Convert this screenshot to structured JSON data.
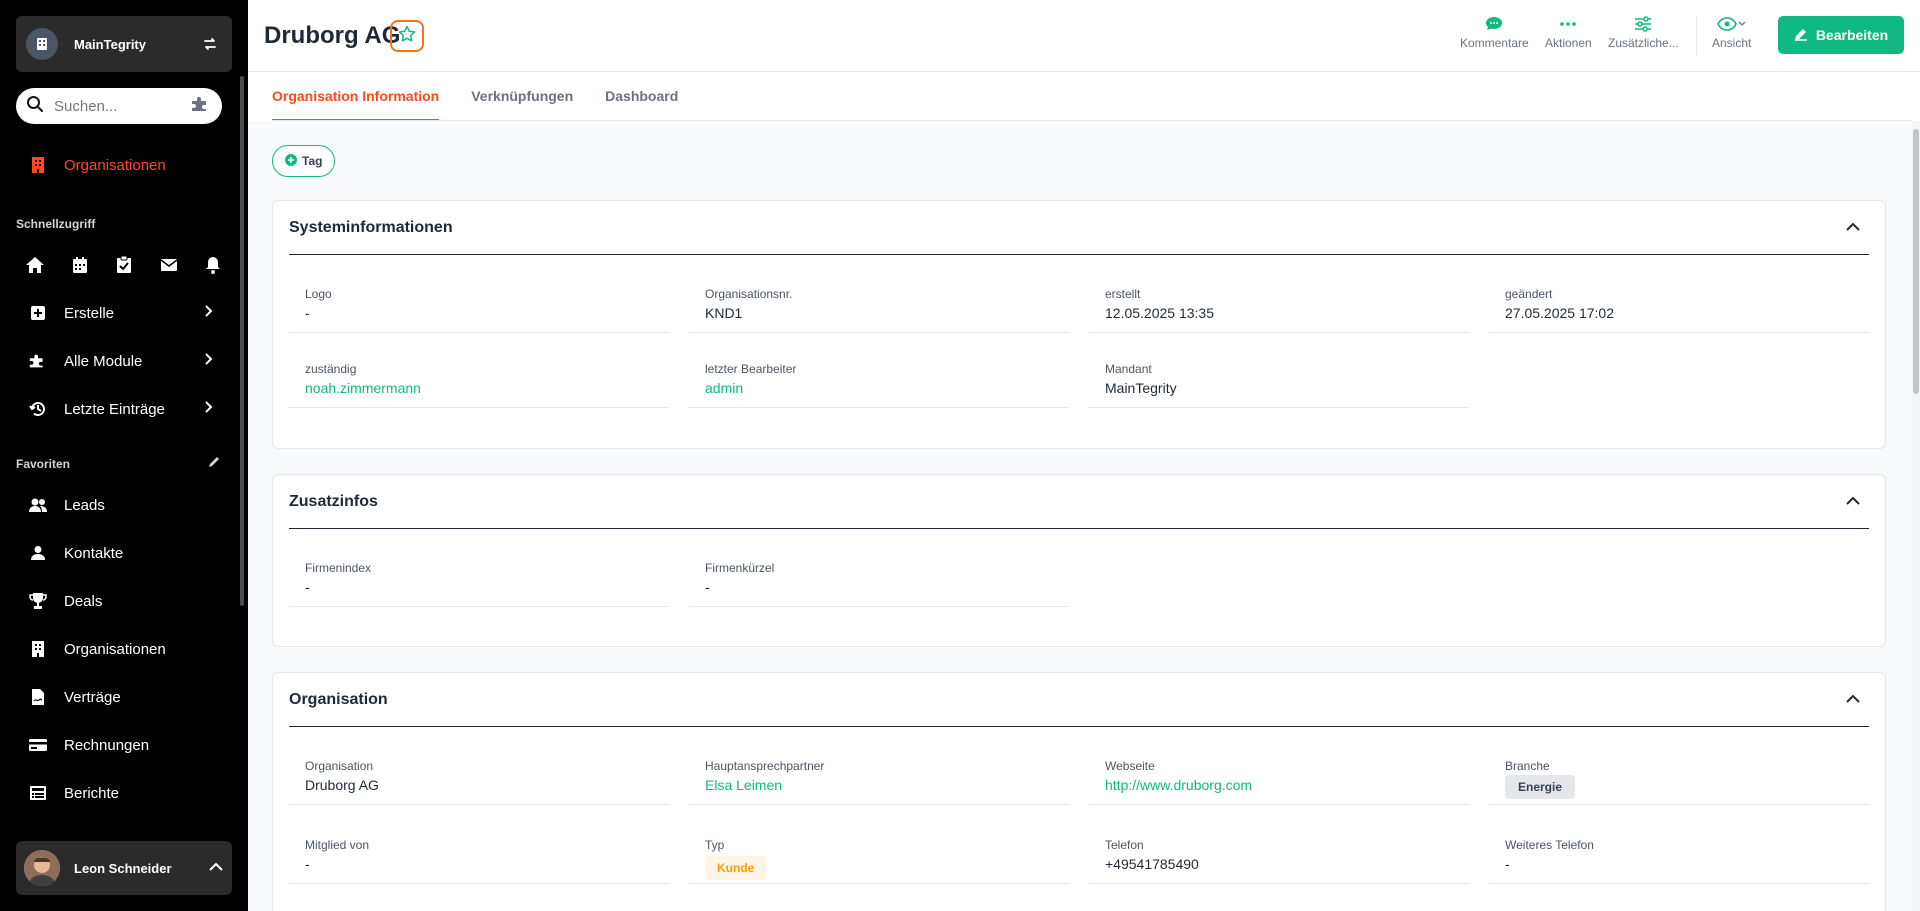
{
  "sidebar": {
    "workspace_name": "MainTegrity",
    "search_placeholder": "Suchen...",
    "primary_item": "Organisationen",
    "quick_access_label": "Schnellzugriff",
    "menu": [
      {
        "label": "Erstelle"
      },
      {
        "label": "Alle Module"
      },
      {
        "label": "Letzte Einträge"
      }
    ],
    "favorites_label": "Favoriten",
    "favorites": [
      {
        "label": "Leads",
        "icon": "users-icon"
      },
      {
        "label": "Kontakte",
        "icon": "user-icon"
      },
      {
        "label": "Deals",
        "icon": "trophy-icon"
      },
      {
        "label": "Organisationen",
        "icon": "building-icon"
      },
      {
        "label": "Verträge",
        "icon": "contract-icon"
      },
      {
        "label": "Rechnungen",
        "icon": "credit-card-icon"
      },
      {
        "label": "Berichte",
        "icon": "report-icon"
      }
    ],
    "user_name": "Leon Schneider"
  },
  "header": {
    "title": "Druborg AG",
    "actions": {
      "comments": "Kommentare",
      "actions": "Aktionen",
      "additional": "Zusätzliche...",
      "view": "Ansicht"
    },
    "edit_label": "Bearbeiten"
  },
  "tabs": [
    {
      "label": "Organisation Information"
    },
    {
      "label": "Verknüpfungen"
    },
    {
      "label": "Dashboard"
    }
  ],
  "tag_label": "Tag",
  "sections": {
    "system": {
      "title": "Systeminformationen",
      "logo": {
        "label": "Logo",
        "value": "-"
      },
      "orgnr": {
        "label": "Organisationsnr.",
        "value": "KND1"
      },
      "created": {
        "label": "erstellt",
        "value": "12.05.2025 13:35"
      },
      "changed": {
        "label": "geändert",
        "value": "27.05.2025 17:02"
      },
      "owner": {
        "label": "zuständig",
        "value": "noah.zimmermann"
      },
      "last_editor": {
        "label": "letzter Bearbeiter",
        "value": "admin"
      },
      "tenant": {
        "label": "Mandant",
        "value": "MainTegrity"
      }
    },
    "extra": {
      "title": "Zusatzinfos",
      "index": {
        "label": "Firmenindex",
        "value": "-"
      },
      "short": {
        "label": "Firmenkürzel",
        "value": "-"
      }
    },
    "org": {
      "title": "Organisation",
      "organisation": {
        "label": "Organisation",
        "value": "Druborg AG"
      },
      "contact": {
        "label": "Hauptansprechpartner",
        "value": "Elsa Leimen"
      },
      "website": {
        "label": "Webseite",
        "value": "http://www.druborg.com"
      },
      "industry": {
        "label": "Branche",
        "value": "Energie"
      },
      "member_of": {
        "label": "Mitglied von",
        "value": "-"
      },
      "type": {
        "label": "Typ",
        "value": "Kunde"
      },
      "phone": {
        "label": "Telefon",
        "value": "+49541785490"
      },
      "phone2": {
        "label": "Weiteres Telefon",
        "value": "-"
      }
    }
  },
  "colors": {
    "accent": "#ff4a1c",
    "primary": "#10b981",
    "sidebar_bg": "#000000"
  }
}
